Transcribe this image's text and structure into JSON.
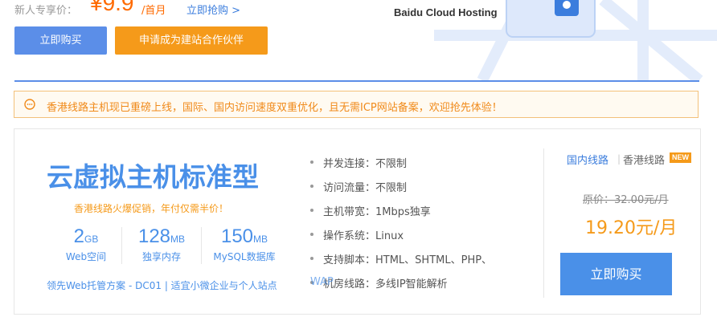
{
  "promo": {
    "label": "新人专享价：",
    "price": "¥9.9",
    "unit": "/首月",
    "link": "立即抢购 >"
  },
  "hosting_title": "Baidu Cloud Hosting",
  "buttons": {
    "buy_now": "立即购买",
    "partner": "申请成为建站合作伙伴"
  },
  "notice": {
    "text": "香港线路主机现已重磅上线，国际、国内访问速度双重优化，且无需ICP网站备案，欢迎抢先体验！"
  },
  "product": {
    "title": "云虚拟主机标准型",
    "subtitle": "香港线路火爆促销，年付仅需半价！",
    "stats": [
      {
        "value": "2",
        "unit": "GB",
        "label": "Web空间"
      },
      {
        "value": "128",
        "unit": "MB",
        "label": "独享内存"
      },
      {
        "value": "150",
        "unit": "MB",
        "label": "MySQL数据库"
      }
    ],
    "plan_line": "领先Web托管方案 - DC01 | 适宜小微企业与个人站点",
    "specs": [
      "并发连接：不限制",
      "访问流量：不限制",
      "主机带宽：1Mbps独享",
      "操作系统：Linux",
      "支持脚本：HTML、SHTML、PHP、",
      "机房线路：多线IP智能解析"
    ],
    "spec_overlap": "WAP",
    "tabs": {
      "domestic": "国内线路",
      "hk": "香港线路",
      "badge": "NEW",
      "sep": "|"
    },
    "original_price": "原价：32.00元/月",
    "sale_price": "19.20元/月",
    "buy_label": "立即购买"
  },
  "colors": {
    "brand_blue": "#4a90e8",
    "orange": "#f59a1a",
    "notice_border": "#f3c07a"
  }
}
